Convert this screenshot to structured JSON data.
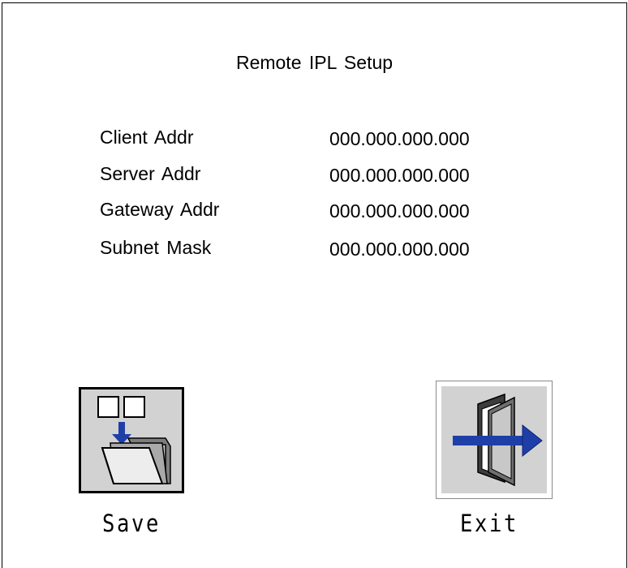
{
  "title": "Remote IPL Setup",
  "fields": [
    {
      "label": "Client Addr",
      "value": "000.000.000.000"
    },
    {
      "label": "Server Addr",
      "value": "000.000.000.000"
    },
    {
      "label": "Gateway Addr",
      "value": "000.000.000.000"
    },
    {
      "label": "Subnet Mask",
      "value": "000.000.000.000"
    }
  ],
  "buttons": {
    "save": {
      "label": "Save",
      "icon": "save-folder-icon"
    },
    "exit": {
      "label": "Exit",
      "icon": "exit-door-icon"
    }
  },
  "colors": {
    "icon_background": "#d2d2d2",
    "arrow_blue": "#1f3fa8"
  }
}
